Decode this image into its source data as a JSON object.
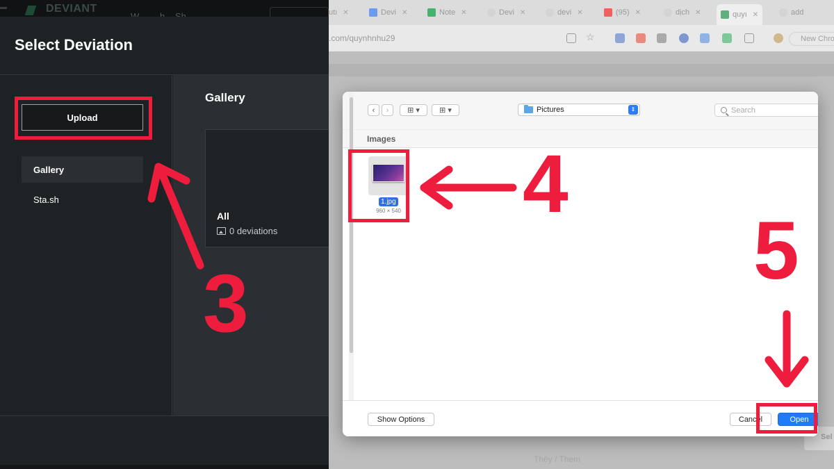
{
  "da_topbar": {
    "brand": "DEVIANT",
    "faint_nav_1": "W",
    "faint_nav_2": "h",
    "faint_nav_3": "Sh"
  },
  "dialog": {
    "title": "Select Deviation",
    "upload_label": "Upload",
    "sidebar": [
      {
        "label": "Gallery",
        "active": true
      },
      {
        "label": "Sta.sh",
        "active": false
      }
    ],
    "main_title": "Gallery",
    "card": {
      "name": "All",
      "count": "0 deviations"
    }
  },
  "browser": {
    "tabs": [
      {
        "label": "utı",
        "icon": "generic-icon",
        "color": "#cfcfcf"
      },
      {
        "label": "Devi",
        "icon": "docs-icon",
        "color": "#6b9bf0"
      },
      {
        "label": "Note",
        "icon": "sheets-icon",
        "color": "#45b36b"
      },
      {
        "label": "Devi",
        "icon": "google-icon",
        "color": "#d4d4d4"
      },
      {
        "label": "devi",
        "icon": "google-icon",
        "color": "#d4d4d4"
      },
      {
        "label": "(95)",
        "icon": "youtube-icon",
        "color": "#f06060"
      },
      {
        "label": "dịch",
        "icon": "google-icon",
        "color": "#d4d4d4"
      },
      {
        "label": "quyı",
        "icon": "deviantart-icon",
        "color": "#5fb07d",
        "active": true
      },
      {
        "label": "add",
        "icon": "google-icon",
        "color": "#d4d4d4"
      }
    ],
    "url": ".com/quynhnhu29",
    "new_chrome": "New Chro"
  },
  "picker": {
    "location": "Pictures",
    "search_placeholder": "Search",
    "section": "Images",
    "file": {
      "name": "1.jpg",
      "size": "960 × 540"
    },
    "show_options": "Show Options",
    "cancel": "Cancel",
    "open": "Open"
  },
  "page_behind": {
    "faint_text": "Thêy / Them",
    "select_label": "Sel"
  },
  "annotations": {
    "step3": "3",
    "step4": "4",
    "step5": "5",
    "color": "#ee1d3d"
  }
}
